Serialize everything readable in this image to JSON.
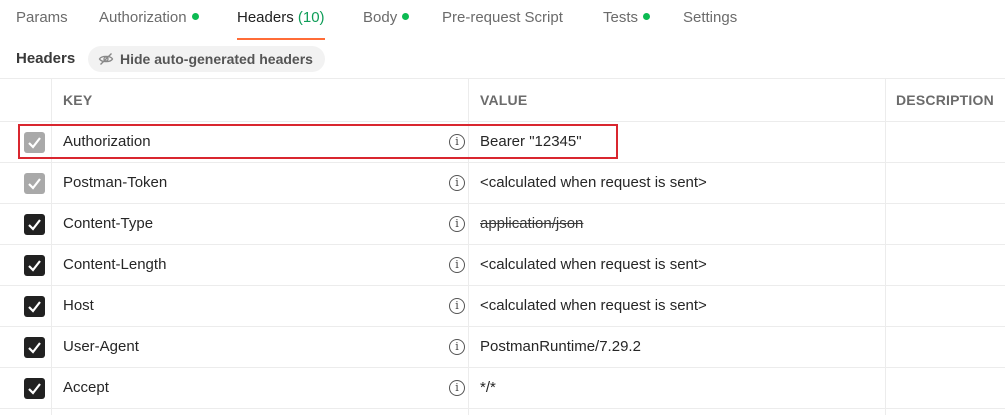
{
  "tabs": [
    {
      "label": "Params",
      "dot": false,
      "count": ""
    },
    {
      "label": "Authorization",
      "dot": true,
      "count": ""
    },
    {
      "label": "Headers",
      "dot": false,
      "count": "(10)",
      "active": true
    },
    {
      "label": "Body",
      "dot": true,
      "count": ""
    },
    {
      "label": "Pre-request Script",
      "dot": false,
      "count": ""
    },
    {
      "label": "Tests",
      "dot": true,
      "count": ""
    },
    {
      "label": "Settings",
      "dot": false,
      "count": ""
    }
  ],
  "headers_section": {
    "title": "Headers",
    "hide_button": "Hide auto-generated headers",
    "hide_icon": "eye-slash-icon"
  },
  "columns": {
    "key": "KEY",
    "value": "VALUE",
    "description": "DESCRIPTION"
  },
  "rows": [
    {
      "checked": true,
      "disabled": true,
      "key": "Authorization",
      "value": "Bearer \"12345\"",
      "strike": false
    },
    {
      "checked": true,
      "disabled": true,
      "key": "Postman-Token",
      "value": "<calculated when request is sent>",
      "strike": false
    },
    {
      "checked": true,
      "disabled": false,
      "key": "Content-Type",
      "value": "application/json",
      "strike": true
    },
    {
      "checked": true,
      "disabled": false,
      "key": "Content-Length",
      "value": "<calculated when request is sent>",
      "strike": false
    },
    {
      "checked": true,
      "disabled": false,
      "key": "Host",
      "value": "<calculated when request is sent>",
      "strike": false
    },
    {
      "checked": true,
      "disabled": false,
      "key": "User-Agent",
      "value": "PostmanRuntime/7.29.2",
      "strike": false
    },
    {
      "checked": true,
      "disabled": false,
      "key": "Accept",
      "value": "*/*",
      "strike": false
    }
  ],
  "colors": {
    "active_tab_underline": "#ff6c37",
    "status_dot": "#0cbb52",
    "count": "#0f9d58",
    "highlight_box": "#d9262f",
    "checkbox_checked": "#212121",
    "checkbox_disabled": "#a9a9a9"
  }
}
